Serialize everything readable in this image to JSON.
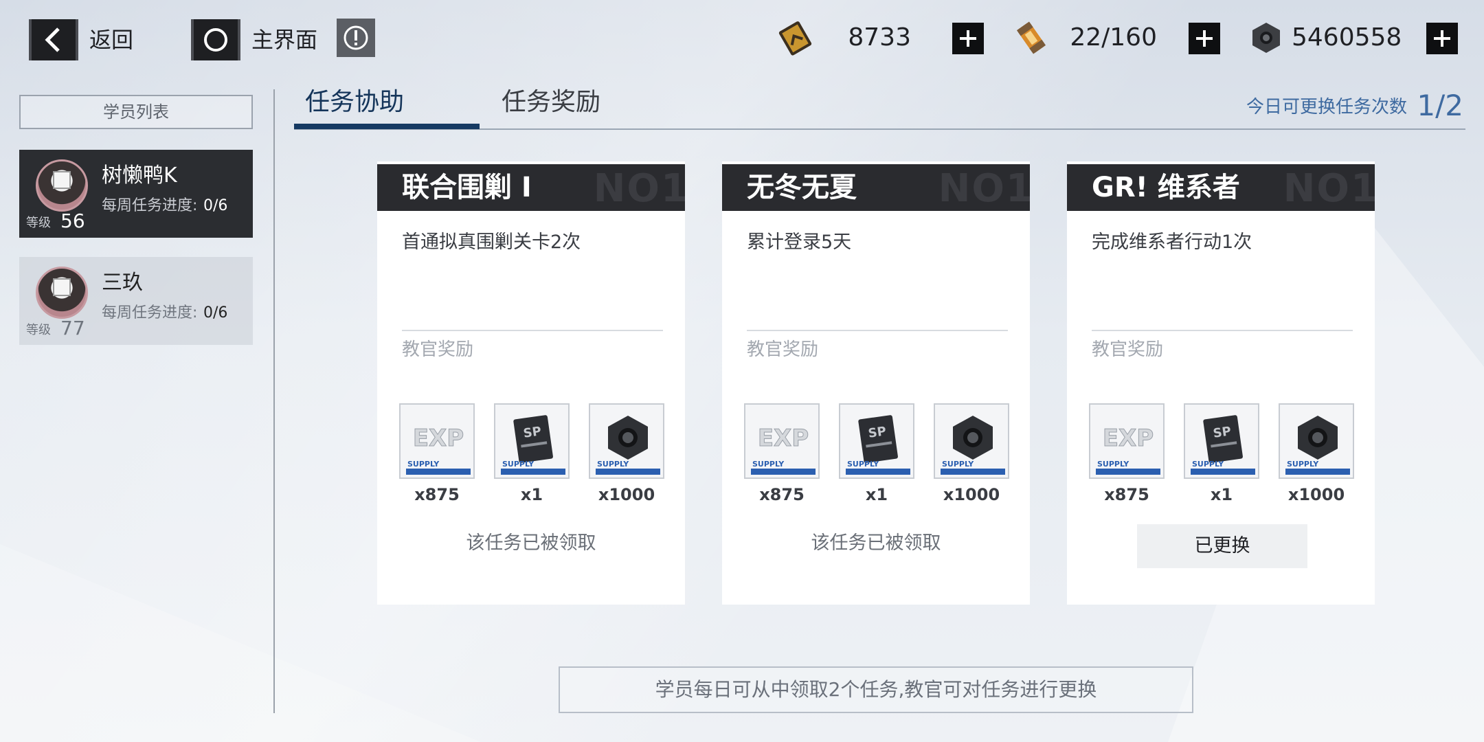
{
  "header": {
    "back_label": "返回",
    "home_label": "主界面"
  },
  "resources": [
    {
      "icon": "battery-ticket-icon",
      "value": "8733"
    },
    {
      "icon": "energy-canister-icon",
      "value": "22/160"
    },
    {
      "icon": "hex-nut-icon",
      "value": "5460558"
    }
  ],
  "sidebar": {
    "title": "学员列表",
    "students": [
      {
        "name": "树懒鸭K",
        "progress_label": "每周任务进度:",
        "progress": "0/6",
        "level_label": "等级",
        "level": "56"
      },
      {
        "name": "三玖",
        "progress_label": "每周任务进度:",
        "progress": "0/6",
        "level_label": "等级",
        "level": "77"
      }
    ]
  },
  "tabs": [
    "任务协助",
    "任务奖励"
  ],
  "swap": {
    "label": "今日可更换任务次数",
    "count": "1/2"
  },
  "cards": [
    {
      "title": "联合围剿 I",
      "badge": "NO1",
      "desc": "首通拟真围剿关卡2次",
      "reward_label": "教官奖励",
      "rewards": [
        {
          "icon": "exp-supply-icon",
          "qty": "x875"
        },
        {
          "icon": "sp-card-supply-icon",
          "qty": "x1"
        },
        {
          "icon": "hex-nut-supply-icon",
          "qty": "x1000"
        }
      ],
      "status": "该任务已被领取"
    },
    {
      "title": "无冬无夏",
      "badge": "NO1",
      "desc": "累计登录5天",
      "reward_label": "教官奖励",
      "rewards": [
        {
          "icon": "exp-supply-icon",
          "qty": "x875"
        },
        {
          "icon": "sp-card-supply-icon",
          "qty": "x1"
        },
        {
          "icon": "hex-nut-supply-icon",
          "qty": "x1000"
        }
      ],
      "status": "该任务已被领取"
    },
    {
      "title": "GR! 维系者",
      "badge": "NO1",
      "desc": "完成维系者行动1次",
      "reward_label": "教官奖励",
      "rewards": [
        {
          "icon": "exp-supply-icon",
          "qty": "x875"
        },
        {
          "icon": "sp-card-supply-icon",
          "qty": "x1"
        },
        {
          "icon": "hex-nut-supply-icon",
          "qty": "x1000"
        }
      ],
      "button": "已更换"
    }
  ],
  "footer_note": "学员每日可从中领取2个任务,教官可对任务进行更换",
  "colors": {
    "accent": "#163a63",
    "swap_text": "#3e6aa0",
    "dark_panel": "#2b2d31"
  }
}
